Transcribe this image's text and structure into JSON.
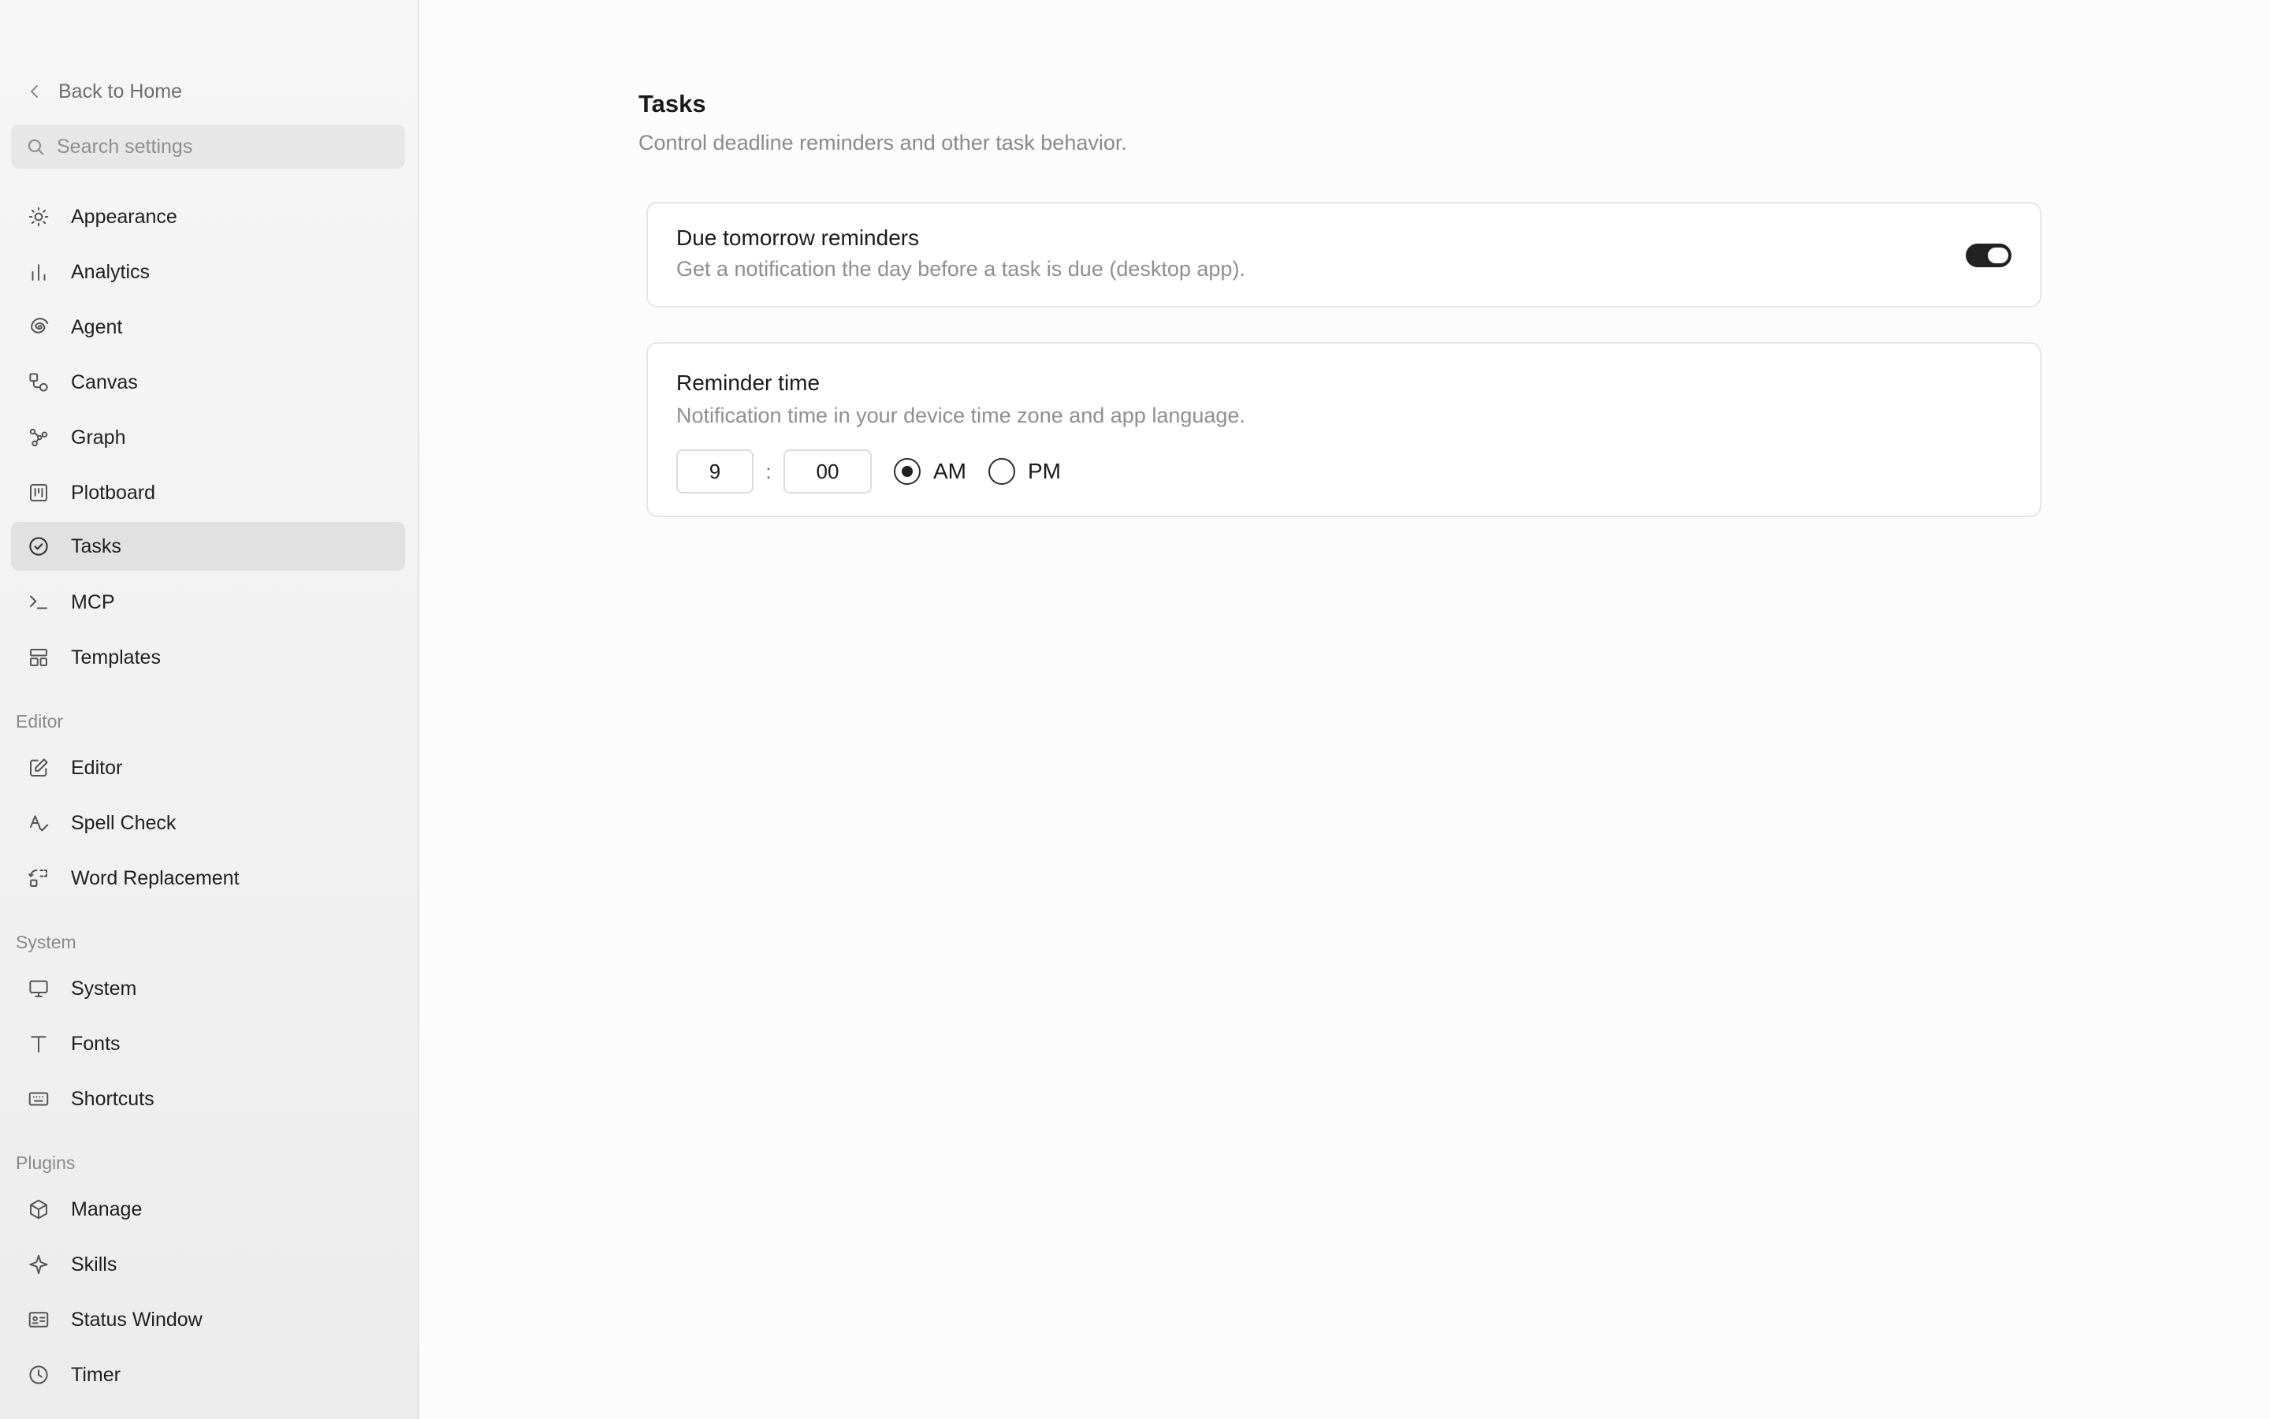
{
  "sidebar": {
    "back_label": "Back to Home",
    "search_placeholder": "Search settings",
    "items": [
      {
        "label": "Appearance",
        "icon": "sun-icon"
      },
      {
        "label": "Analytics",
        "icon": "bar-chart-icon"
      },
      {
        "label": "Agent",
        "icon": "spiral-icon"
      },
      {
        "label": "Canvas",
        "icon": "canvas-icon"
      },
      {
        "label": "Graph",
        "icon": "graph-icon"
      },
      {
        "label": "Plotboard",
        "icon": "kanban-icon"
      },
      {
        "label": "Tasks",
        "icon": "check-circle-icon",
        "active": true
      },
      {
        "label": "MCP",
        "icon": "terminal-icon"
      },
      {
        "label": "Templates",
        "icon": "template-icon"
      }
    ],
    "sections": [
      {
        "label": "Editor",
        "items": [
          {
            "label": "Editor",
            "icon": "pencil-square-icon"
          },
          {
            "label": "Spell Check",
            "icon": "spell-check-icon"
          },
          {
            "label": "Word Replacement",
            "icon": "replace-icon"
          }
        ]
      },
      {
        "label": "System",
        "items": [
          {
            "label": "System",
            "icon": "monitor-icon"
          },
          {
            "label": "Fonts",
            "icon": "type-icon"
          },
          {
            "label": "Shortcuts",
            "icon": "keyboard-icon"
          }
        ]
      },
      {
        "label": "Plugins",
        "items": [
          {
            "label": "Manage",
            "icon": "package-icon"
          },
          {
            "label": "Skills",
            "icon": "sparkle-icon"
          },
          {
            "label": "Status Window",
            "icon": "id-card-icon"
          },
          {
            "label": "Timer",
            "icon": "clock-icon"
          }
        ]
      }
    ]
  },
  "main": {
    "title": "Tasks",
    "subtitle": "Control deadline reminders and other task behavior.",
    "due_reminders": {
      "title": "Due tomorrow reminders",
      "description": "Get a notification the day before a task is due (desktop app).",
      "enabled": true
    },
    "reminder_time": {
      "title": "Reminder time",
      "description": "Notification time in your device time zone and app language.",
      "hour": "9",
      "separator": ":",
      "minute": "00",
      "am_label": "AM",
      "pm_label": "PM",
      "period": "AM"
    }
  },
  "colors": {
    "sidebar_bg": "#f4f4f4",
    "active_item_bg": "#e1e1e1",
    "toggle_on": "#222222",
    "muted_text": "#8a8a8a"
  }
}
